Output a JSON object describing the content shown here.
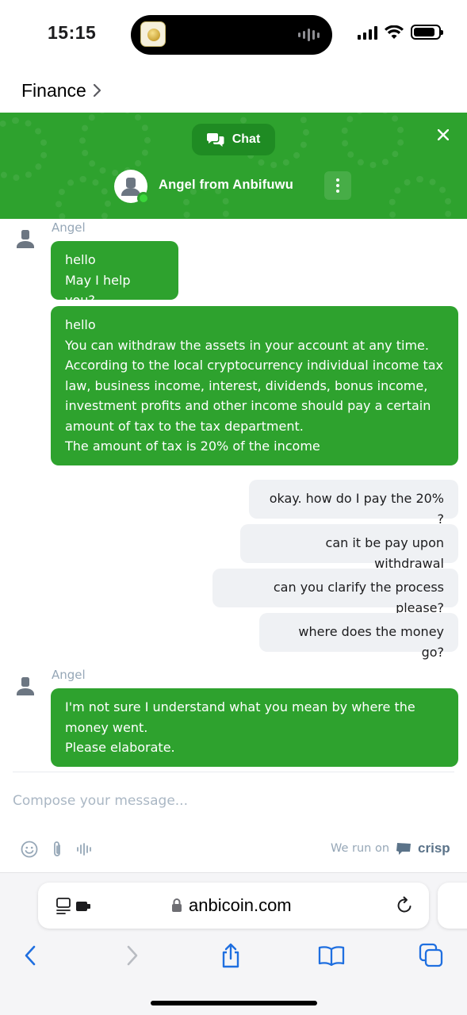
{
  "status_bar": {
    "time": "15:15"
  },
  "app_nav": {
    "label": "Finance"
  },
  "chat_header": {
    "tab_label": "Chat",
    "agent_name": "Angel from Anbifuwu",
    "accent": "#2ea22e"
  },
  "messages": [
    {
      "sender": "agent",
      "name": "Angel",
      "text": "hello\nMay I help you?"
    },
    {
      "sender": "agent",
      "text": "hello\nYou can withdraw the assets in your account at any time.\nAccording to the local cryptocurrency individual income tax\nlaw, business income, interest, dividends, bonus income,\ninvestment profits and other income should pay a certain\namount of tax to the tax department.\nThe amount of tax is 20% of the income"
    },
    {
      "sender": "user",
      "text": "okay. how do I pay the 20% ?"
    },
    {
      "sender": "user",
      "text": "can it be pay upon withdrawal"
    },
    {
      "sender": "user",
      "text": "can you clarify the process please?"
    },
    {
      "sender": "user",
      "text": "where does the money go?"
    },
    {
      "sender": "agent",
      "name": "Angel",
      "text": "I'm not sure I understand what you mean by where the\nmoney went.\nPlease elaborate."
    }
  ],
  "compose": {
    "placeholder": "Compose your message..."
  },
  "footer": {
    "powered_by": "We run on",
    "brand": "crisp"
  },
  "browser": {
    "url": "anbicoin.com"
  }
}
